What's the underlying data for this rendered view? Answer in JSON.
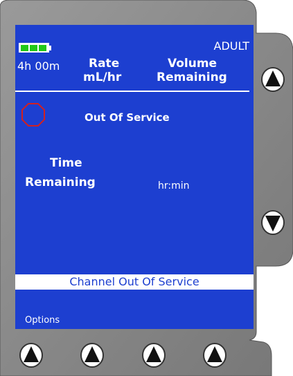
{
  "screen": {
    "patient_mode": "ADULT",
    "battery_time": "4h 00m",
    "battery_level": 1.0,
    "rate_header_line1": "Rate",
    "rate_header_line2": "mL/hr",
    "volume_header_line1": "Volume",
    "volume_header_line2": "Remaining",
    "status_message": "Out Of Service",
    "time_remaining_line1": "Time",
    "time_remaining_line2": "Remaining",
    "time_unit": "hr:min",
    "channel_status": "Channel Out Of Service",
    "softkey_label": "Options"
  },
  "colors": {
    "screen_bg": "#1d3fd0",
    "battery_fill": "#22c818",
    "stop_icon": "#d22020",
    "bezel": "#8a8a8a"
  },
  "icons": {
    "scroll_up": "arrow-up-icon",
    "scroll_down": "arrow-down-icon",
    "softkey": "arrow-up-icon",
    "stop": "octagon-stop-icon"
  }
}
